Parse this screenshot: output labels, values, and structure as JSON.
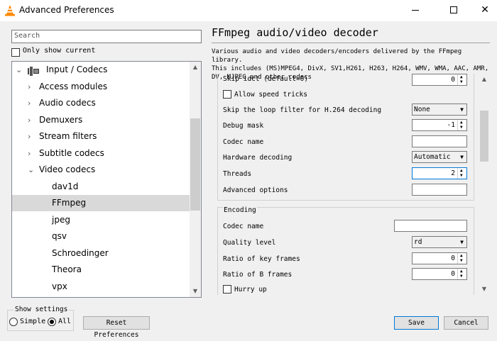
{
  "window": {
    "title": "Advanced Preferences"
  },
  "search": {
    "placeholder": "Search"
  },
  "only_show_current": {
    "label": "Only show current"
  },
  "tree": {
    "items": [
      {
        "label": "Input / Codecs",
        "level": 0,
        "expanded": true,
        "selected": false
      },
      {
        "label": "Access modules",
        "level": 1,
        "expanded": false,
        "selected": false
      },
      {
        "label": "Audio codecs",
        "level": 1,
        "expanded": false,
        "selected": false
      },
      {
        "label": "Demuxers",
        "level": 1,
        "expanded": false,
        "selected": false
      },
      {
        "label": "Stream filters",
        "level": 1,
        "expanded": false,
        "selected": false
      },
      {
        "label": "Subtitle codecs",
        "level": 1,
        "expanded": false,
        "selected": false
      },
      {
        "label": "Video codecs",
        "level": 1,
        "expanded": true,
        "selected": false
      },
      {
        "label": "dav1d",
        "level": 2,
        "selected": false
      },
      {
        "label": "FFmpeg",
        "level": 2,
        "selected": true
      },
      {
        "label": "jpeg",
        "level": 2,
        "selected": false
      },
      {
        "label": "qsv",
        "level": 2,
        "selected": false
      },
      {
        "label": "Schroedinger",
        "level": 2,
        "selected": false
      },
      {
        "label": "Theora",
        "level": 2,
        "selected": false
      },
      {
        "label": "vpx",
        "level": 2,
        "selected": false
      }
    ]
  },
  "panel": {
    "title": "FFmpeg audio/video decoder",
    "description": "Various audio and video decoders/encoders delivered by the FFmpeg library.\nThis includes (MS)MPEG4, DivX, SV1,H261, H263, H264, WMV, WMA, AAC, AMR,\nDV, MJPEG and other codecs"
  },
  "decoding": {
    "skip_idct": {
      "label": "Skip idct (default=0)",
      "value": "0"
    },
    "allow_speed_tricks": {
      "label": "Allow speed tricks",
      "checked": false
    },
    "skip_loop_filter": {
      "label": "Skip the loop filter for H.264 decoding",
      "value": "None"
    },
    "debug_mask": {
      "label": "Debug mask",
      "value": "-1"
    },
    "codec_name": {
      "label": "Codec name",
      "value": ""
    },
    "hardware_decoding": {
      "label": "Hardware decoding",
      "value": "Automatic"
    },
    "threads": {
      "label": "Threads",
      "value": "2"
    },
    "advanced_options": {
      "label": "Advanced options",
      "value": ""
    }
  },
  "encoding": {
    "legend": "Encoding",
    "codec_name": {
      "label": "Codec name",
      "value": ""
    },
    "quality_level": {
      "label": "Quality level",
      "value": "rd"
    },
    "ratio_key_frames": {
      "label": "Ratio of key frames",
      "value": "0"
    },
    "ratio_b_frames": {
      "label": "Ratio of B frames",
      "value": "0"
    },
    "hurry_up": {
      "label": "Hurry up",
      "checked": false
    }
  },
  "show_settings": {
    "legend": "Show settings",
    "simple_label": "Simple",
    "all_label": "All",
    "selected": "All"
  },
  "buttons": {
    "reset": "Reset Preferences",
    "save": "Save",
    "cancel": "Cancel"
  },
  "colors": {
    "selection": "#d9d9d9",
    "focus": "#0078d7",
    "vlc_orange": "#ff8800"
  }
}
